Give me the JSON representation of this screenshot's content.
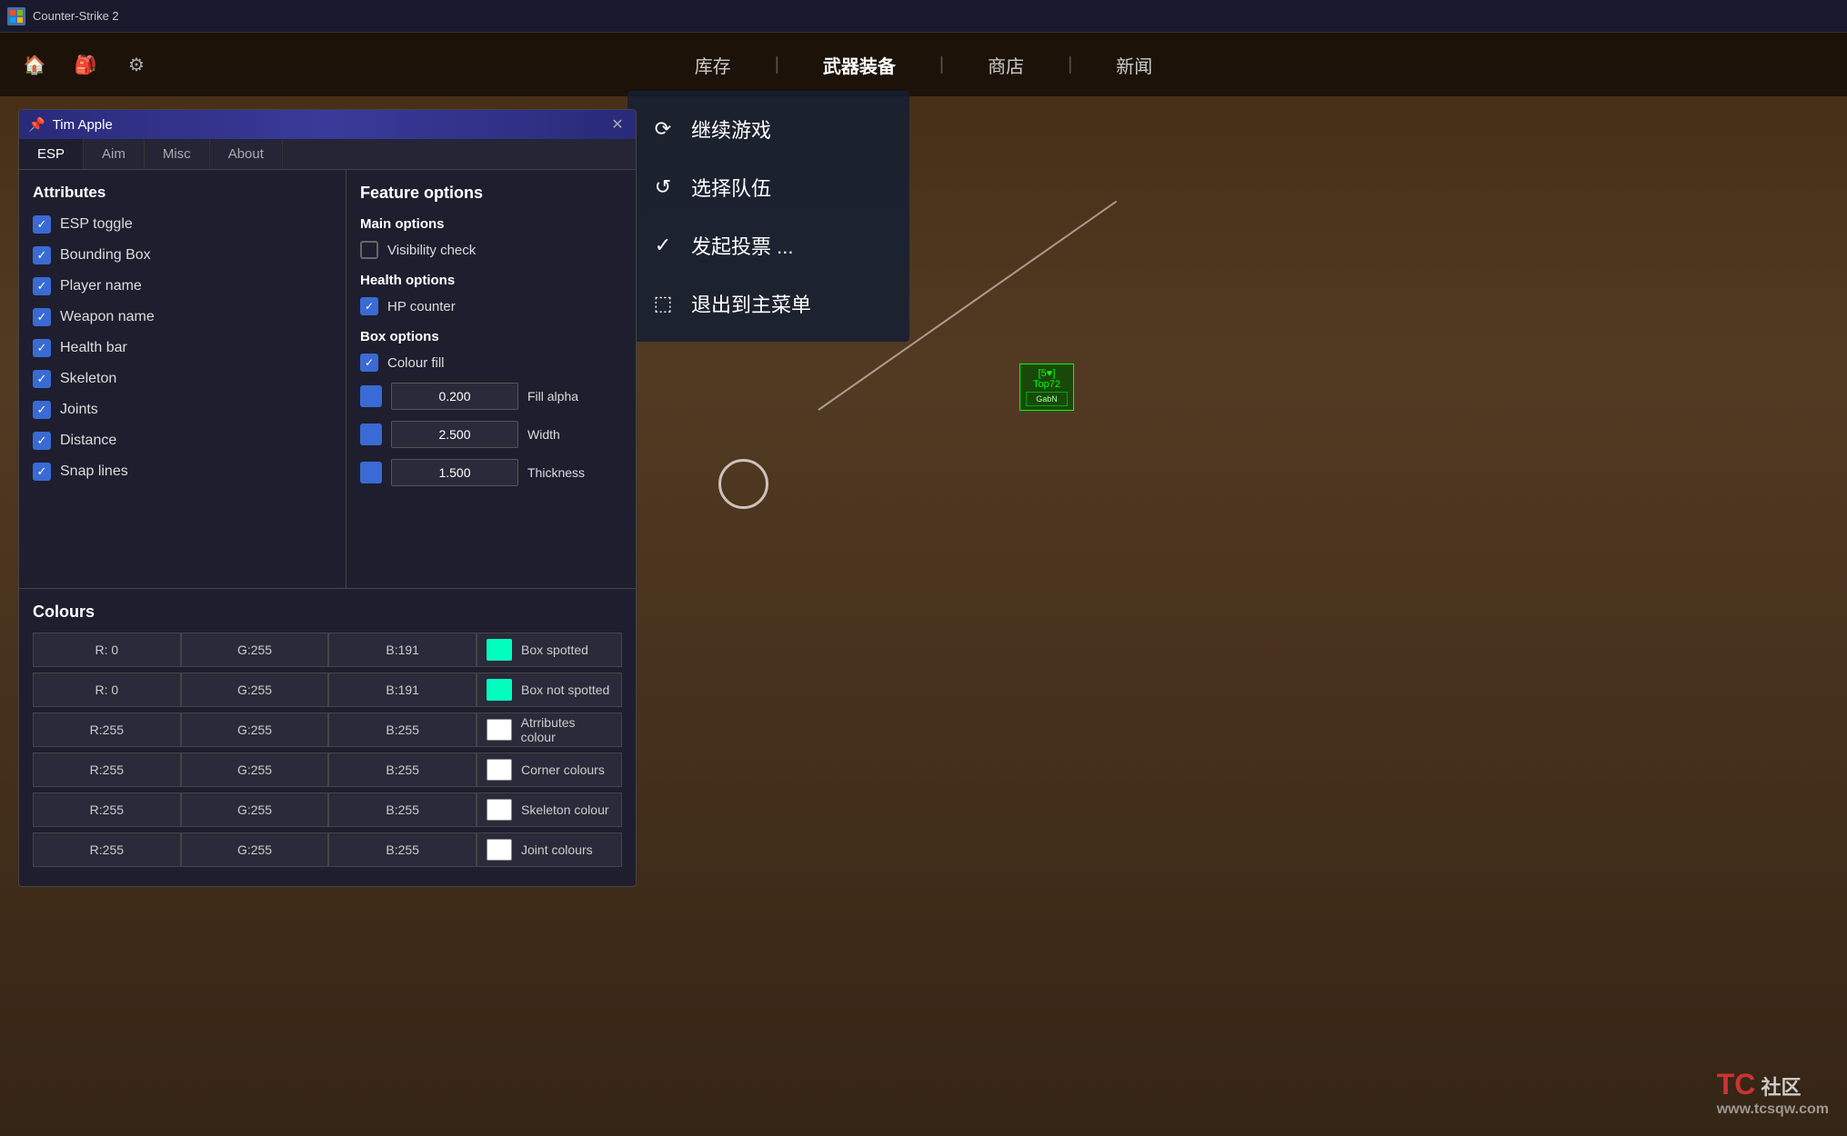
{
  "window": {
    "title": "Counter-Strike 2",
    "top_bar_icon": "🎮"
  },
  "cs2_nav": {
    "links": [
      "库存",
      "武器装备",
      "商店",
      "新闻"
    ],
    "active_index": 1,
    "separators": [
      "|",
      "|",
      "|"
    ]
  },
  "cheat_panel": {
    "title": "Tim Apple",
    "pin_icon": "📌",
    "close_icon": "✕",
    "tabs": [
      "ESP",
      "Aim",
      "Misc",
      "About"
    ],
    "active_tab": "ESP"
  },
  "attributes": {
    "title": "Attributes",
    "items": [
      {
        "label": "ESP toggle",
        "checked": true
      },
      {
        "label": "Bounding Box",
        "checked": true
      },
      {
        "label": "Player name",
        "checked": true
      },
      {
        "label": "Weapon name",
        "checked": true
      },
      {
        "label": "Health bar",
        "checked": true
      },
      {
        "label": "Skeleton",
        "checked": true
      },
      {
        "label": "Joints",
        "checked": true
      },
      {
        "label": "Distance",
        "checked": true
      },
      {
        "label": "Snap lines",
        "checked": true
      }
    ]
  },
  "feature_options": {
    "title": "Feature options",
    "main_options": {
      "title": "Main options",
      "items": [
        {
          "label": "Visibility check",
          "checked": false
        }
      ]
    },
    "health_options": {
      "title": "Health options",
      "items": [
        {
          "label": "HP counter",
          "checked": true
        }
      ]
    },
    "box_options": {
      "title": "Box options",
      "items": [
        {
          "label": "Colour fill",
          "checked": true
        }
      ],
      "sliders": [
        {
          "value": "0.200",
          "name": "Fill alpha",
          "color": "#3a6ad4"
        },
        {
          "value": "2.500",
          "name": "Width",
          "color": "#3a6ad4"
        },
        {
          "value": "1.500",
          "name": "Thickness",
          "color": "#3a6ad4"
        }
      ]
    }
  },
  "colours": {
    "title": "Colours",
    "rows": [
      {
        "r": "R: 0",
        "g": "G:255",
        "b": "B:191",
        "swatch": "#00ffbf",
        "label": "Box spotted"
      },
      {
        "r": "R: 0",
        "g": "G:255",
        "b": "B:191",
        "swatch": "#00ffbf",
        "label": "Box not spotted"
      },
      {
        "r": "R:255",
        "g": "G:255",
        "b": "B:255",
        "swatch": "#ffffff",
        "label": "Atrributes colour"
      },
      {
        "r": "R:255",
        "g": "G:255",
        "b": "B:255",
        "swatch": "#ffffff",
        "label": "Corner colours"
      },
      {
        "r": "R:255",
        "g": "G:255",
        "b": "B:255",
        "swatch": "#ffffff",
        "label": "Skeleton colour"
      },
      {
        "r": "R:255",
        "g": "G:255",
        "b": "B:255",
        "swatch": "#ffffff",
        "label": "Joint colours"
      }
    ]
  },
  "game_menu": {
    "items": [
      {
        "icon": "↺",
        "label": "继续游戏"
      },
      {
        "icon": "⟳",
        "label": "选择队伍"
      },
      {
        "icon": "✓",
        "label": "发起投票 ..."
      },
      {
        "icon": "⬚",
        "label": "退出到主菜单"
      }
    ]
  },
  "player_indicator": {
    "line1": "[5♥]",
    "line2": "Top72",
    "player": "GabN"
  },
  "watermark": {
    "brand": "TC",
    "url": "www.tcsqw.com",
    "decoration": "社区"
  }
}
